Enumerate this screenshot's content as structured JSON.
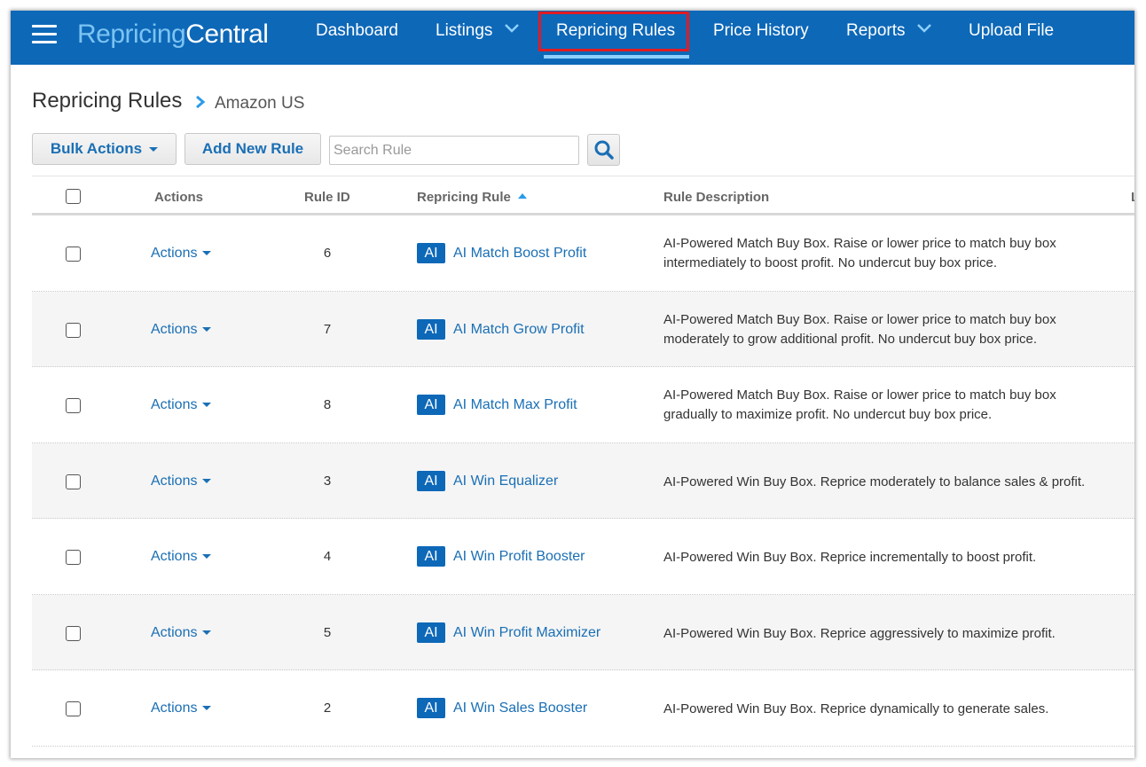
{
  "app": {
    "logo_part1": "Repricing",
    "logo_part2": "Central"
  },
  "nav": {
    "items": [
      {
        "label": "Dashboard",
        "has_dropdown": false
      },
      {
        "label": "Listings",
        "has_dropdown": true
      },
      {
        "label": "Repricing Rules",
        "has_dropdown": false,
        "active": true
      },
      {
        "label": "Price History",
        "has_dropdown": false
      },
      {
        "label": "Reports",
        "has_dropdown": true
      },
      {
        "label": "Upload File",
        "has_dropdown": false
      }
    ]
  },
  "breadcrumb": {
    "title": "Repricing Rules",
    "sub": "Amazon US"
  },
  "toolbar": {
    "bulk_actions_label": "Bulk Actions",
    "add_rule_label": "Add New Rule",
    "search_placeholder": "Search Rule",
    "search_value": ""
  },
  "table": {
    "headers": {
      "actions": "Actions",
      "rule_id": "Rule ID",
      "repricing_rule": "Repricing Rule",
      "rule_description": "Rule Description",
      "truncated_next": "L"
    },
    "sort": {
      "column": "repricing_rule",
      "direction": "ascending"
    },
    "rows": [
      {
        "actions": "Actions",
        "id": "6",
        "badge": "AI",
        "name": "AI Match Boost Profit",
        "desc_lines": [
          "AI-Powered Match Buy Box. Raise or lower price to match buy box",
          "intermediately to boost profit. No undercut buy box price."
        ]
      },
      {
        "actions": "Actions",
        "id": "7",
        "badge": "AI",
        "name": "AI Match Grow Profit",
        "desc_lines": [
          "AI-Powered Match Buy Box. Raise or lower price to match buy box",
          "moderately to grow additional profit. No undercut buy box price."
        ]
      },
      {
        "actions": "Actions",
        "id": "8",
        "badge": "AI",
        "name": "AI Match Max Profit",
        "desc_lines": [
          "AI-Powered Match Buy Box. Raise or lower price to match buy box",
          "gradually to maximize profit. No undercut buy box price."
        ]
      },
      {
        "actions": "Actions",
        "id": "3",
        "badge": "AI",
        "name": "AI Win Equalizer",
        "desc_lines": [
          "AI-Powered Win Buy Box. Reprice moderately to balance sales & profit."
        ]
      },
      {
        "actions": "Actions",
        "id": "4",
        "badge": "AI",
        "name": "AI Win Profit Booster",
        "desc_lines": [
          "AI-Powered Win Buy Box. Reprice incrementally to boost profit."
        ]
      },
      {
        "actions": "Actions",
        "id": "5",
        "badge": "AI",
        "name": "AI Win Profit Maximizer",
        "desc_lines": [
          "AI-Powered Win Buy Box. Reprice aggressively to maximize profit."
        ]
      },
      {
        "actions": "Actions",
        "id": "2",
        "badge": "AI",
        "name": "AI Win Sales Booster",
        "desc_lines": [
          "AI-Powered Win Buy Box. Reprice dynamically to generate sales."
        ]
      }
    ]
  },
  "colors": {
    "nav_bg": "#0d68b8",
    "logo_accent": "#7cc3f2",
    "active_box": "#e11b22",
    "link": "#1a6fb5"
  },
  "icons": {
    "menu": "hamburger-icon",
    "chevron": "chevron-down-icon",
    "breadcrumb_sep": "chevron-right-icon",
    "search": "search-icon",
    "sort": "sort-up-icon"
  }
}
